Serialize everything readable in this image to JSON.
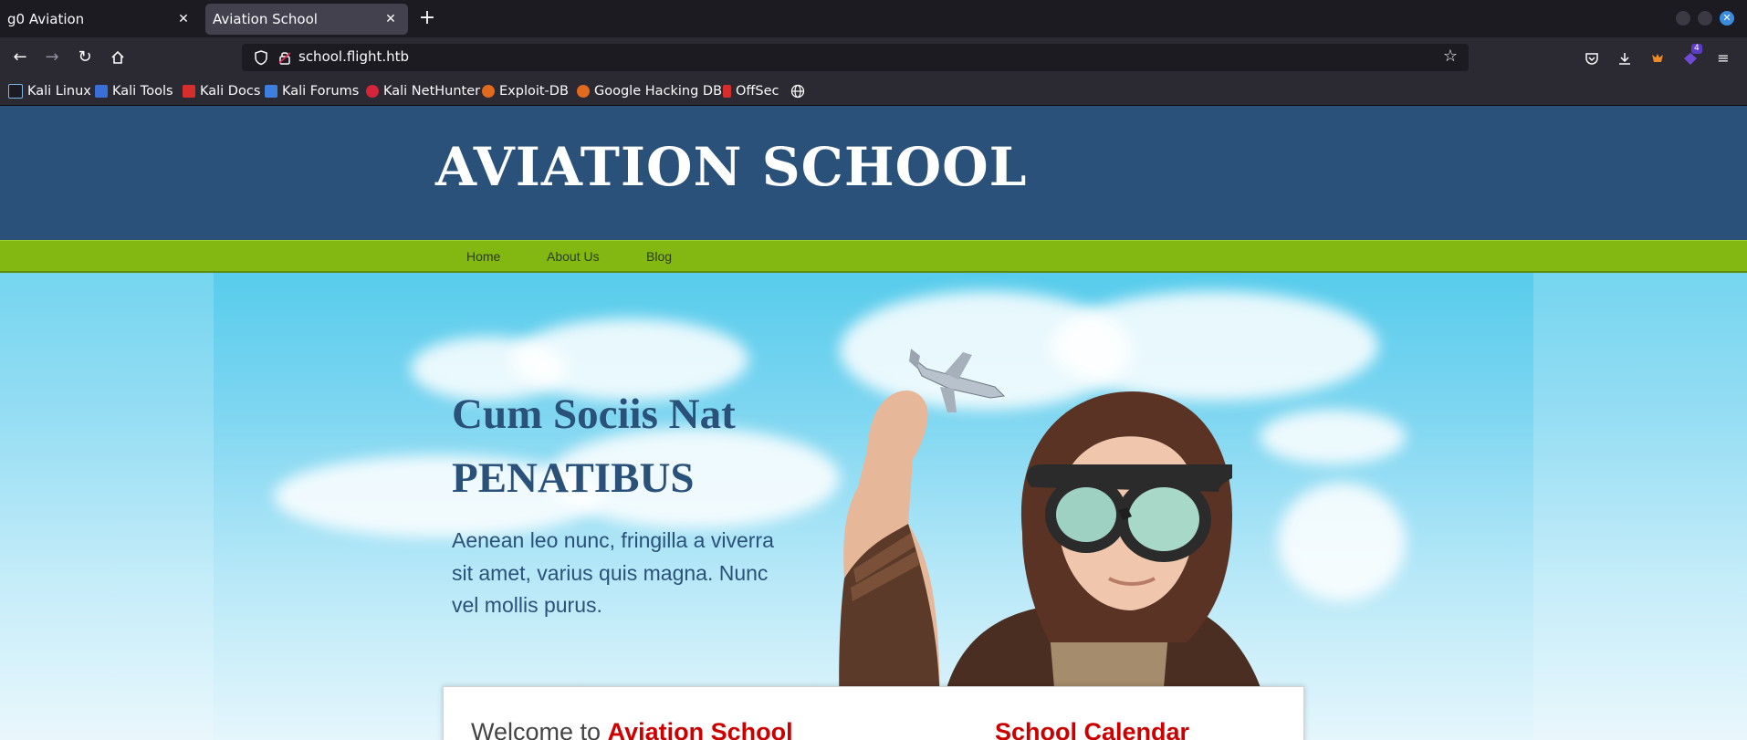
{
  "browser": {
    "tabs": [
      {
        "title": "g0 Aviation",
        "active": false
      },
      {
        "title": "Aviation School",
        "active": true
      }
    ],
    "url": "school.flight.htb",
    "notification_count": "4",
    "bookmarks": [
      {
        "label": "Kali Linux",
        "icon": "kali-dragon-icon"
      },
      {
        "label": "Kali Tools",
        "icon": "kali-tools-icon"
      },
      {
        "label": "Kali Docs",
        "icon": "kali-docs-icon"
      },
      {
        "label": "Kali Forums",
        "icon": "kali-forums-icon"
      },
      {
        "label": "Kali NetHunter",
        "icon": "nethunter-icon"
      },
      {
        "label": "Exploit-DB",
        "icon": "exploit-db-icon"
      },
      {
        "label": "Google Hacking DB",
        "icon": "ghdb-icon"
      },
      {
        "label": "OffSec",
        "icon": "offsec-icon"
      }
    ]
  },
  "site": {
    "title": "AVIATION SCHOOL",
    "nav": [
      "Home",
      "About Us",
      "Blog"
    ],
    "hero": {
      "heading_line1": "Cum Sociis Nat",
      "heading_line2": "PENATIBUS",
      "paragraph": "Aenean leo nunc, fringilla a viverra sit amet, varius quis magna. Nunc vel mollis purus."
    },
    "welcome_prefix": "Welcome to",
    "welcome_accent": "Aviation School",
    "calendar_heading": "School Calendar"
  },
  "colors": {
    "header_blue": "#2a5179",
    "nav_green": "#82b811",
    "accent_red": "#cc0000",
    "sky_blue": "#57ccec"
  }
}
